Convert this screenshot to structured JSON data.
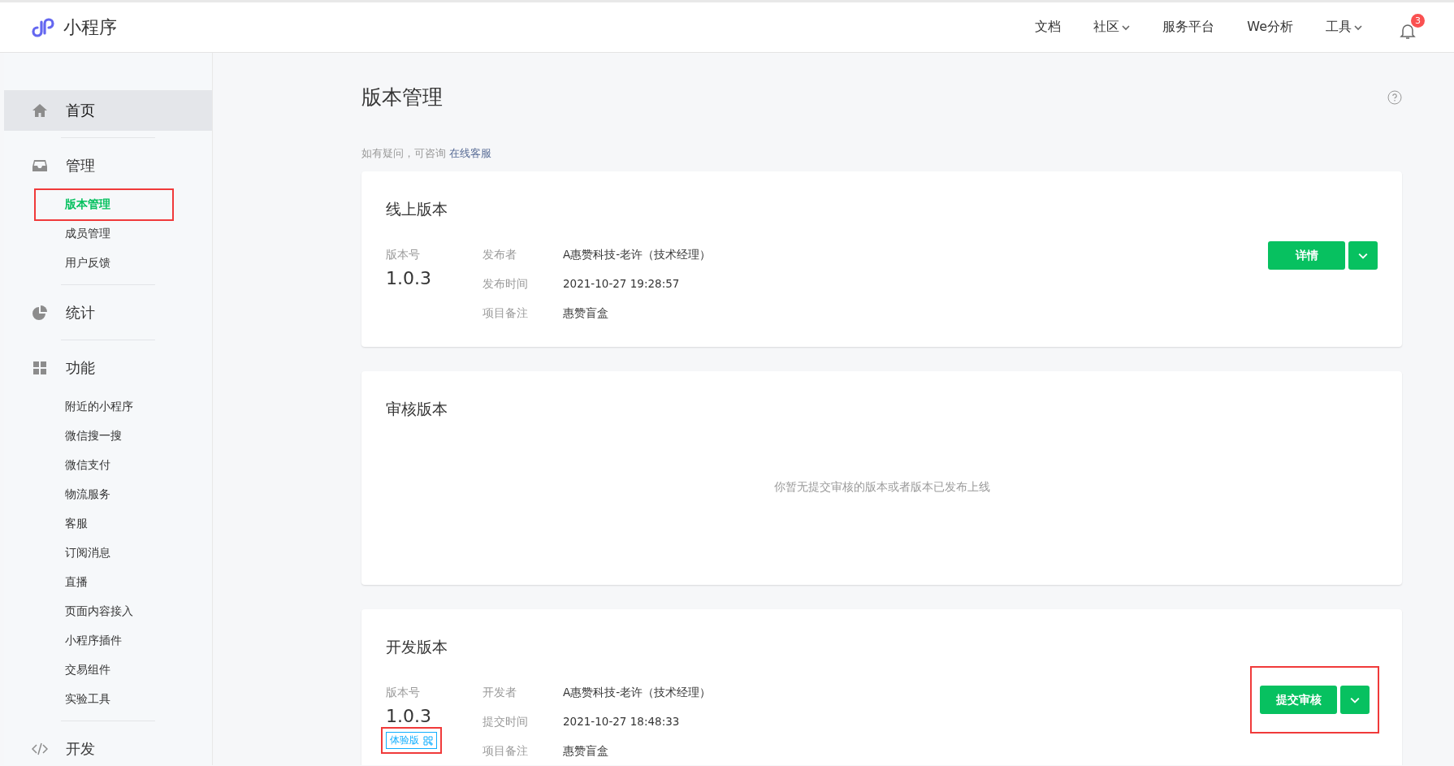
{
  "header": {
    "logo": "小程序",
    "nav": [
      {
        "label": "文档",
        "dropdown": false
      },
      {
        "label": "社区",
        "dropdown": true
      },
      {
        "label": "服务平台",
        "dropdown": false
      },
      {
        "label": "We分析",
        "dropdown": false
      },
      {
        "label": "工具",
        "dropdown": true
      }
    ],
    "notifications": "3"
  },
  "sidebar": {
    "sections": [
      {
        "kind": "home",
        "label": "首页",
        "selected": true
      },
      {
        "kind": "manage",
        "label": "管理",
        "selected": false,
        "items": [
          {
            "label": "版本管理",
            "selected": true,
            "highlighted": true
          },
          {
            "label": "成员管理",
            "selected": false,
            "highlighted": false
          },
          {
            "label": "用户反馈",
            "selected": false,
            "highlighted": false
          }
        ]
      },
      {
        "kind": "stats",
        "label": "统计",
        "selected": false
      },
      {
        "kind": "features",
        "label": "功能",
        "selected": false,
        "items": [
          {
            "label": "附近的小程序",
            "selected": false,
            "highlighted": false
          },
          {
            "label": "微信搜一搜",
            "selected": false,
            "highlighted": false
          },
          {
            "label": "微信支付",
            "selected": false,
            "highlighted": false
          },
          {
            "label": "物流服务",
            "selected": false,
            "highlighted": false
          },
          {
            "label": "客服",
            "selected": false,
            "highlighted": false
          },
          {
            "label": "订阅消息",
            "selected": false,
            "highlighted": false
          },
          {
            "label": "直播",
            "selected": false,
            "highlighted": false
          },
          {
            "label": "页面内容接入",
            "selected": false,
            "highlighted": false
          },
          {
            "label": "小程序插件",
            "selected": false,
            "highlighted": false
          },
          {
            "label": "交易组件",
            "selected": false,
            "highlighted": false
          },
          {
            "label": "实验工具",
            "selected": false,
            "highlighted": false
          }
        ]
      },
      {
        "kind": "dev",
        "label": "开发",
        "selected": false
      }
    ]
  },
  "main": {
    "title": "版本管理",
    "notice": {
      "text": "如有疑问，可咨询",
      "link": "在线客服"
    },
    "cards": [
      {
        "kind": "version",
        "title": "线上版本",
        "version_label": "版本号",
        "version": "1.0.3",
        "fields": [
          {
            "label": "发布者",
            "value": "A惠赞科技-老许（技术经理）"
          },
          {
            "label": "发布时间",
            "value": "2021-10-27 19:28:57"
          },
          {
            "label": "项目备注",
            "value": "惠赞盲盒"
          }
        ],
        "primary_button": "详情",
        "actions_highlighted": false
      },
      {
        "kind": "empty",
        "title": "审核版本",
        "message": "你暂无提交审核的版本或者版本已发布上线"
      },
      {
        "kind": "version",
        "title": "开发版本",
        "version_label": "版本号",
        "version": "1.0.3",
        "badge": {
          "label": "体验版",
          "highlighted": true
        },
        "fields": [
          {
            "label": "开发者",
            "value": "A惠赞科技-老许（技术经理）"
          },
          {
            "label": "提交时间",
            "value": "2021-10-27 18:48:33"
          },
          {
            "label": "项目备注",
            "value": "惠赞盲盒"
          }
        ],
        "primary_button": "提交审核",
        "actions_highlighted": true
      }
    ]
  }
}
